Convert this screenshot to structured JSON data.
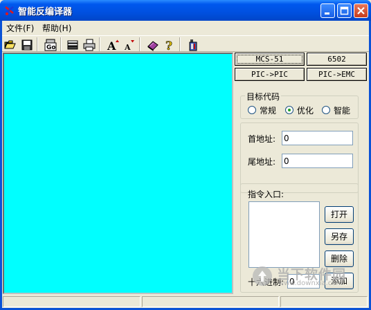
{
  "window": {
    "title": "智能反编译器"
  },
  "menu": [
    {
      "label": "文件(F)"
    },
    {
      "label": "帮助(H)"
    }
  ],
  "toolbar": {
    "buttons": [
      {
        "icon": "open-folder-icon"
      },
      {
        "icon": "save-disk-icon"
      },
      {
        "icon": "go-icon",
        "label": "Go"
      },
      {
        "icon": "print-setup-icon"
      },
      {
        "icon": "print-icon"
      },
      {
        "icon": "font-increase-icon",
        "label": "A"
      },
      {
        "icon": "font-decrease-icon",
        "label": "A"
      },
      {
        "icon": "book-icon"
      },
      {
        "icon": "help-icon",
        "label": "?"
      },
      {
        "icon": "about-icon"
      }
    ]
  },
  "display": {
    "background": "#00ffff"
  },
  "cpu_buttons": [
    {
      "label": "MCS-51"
    },
    {
      "label": "6502"
    },
    {
      "label": "PIC->PIC"
    },
    {
      "label": "PIC->EMC"
    }
  ],
  "target_code": {
    "title": "目标代码",
    "options": [
      {
        "label": "常规",
        "checked": false
      },
      {
        "label": "优化",
        "checked": true
      },
      {
        "label": "智能",
        "checked": false
      }
    ]
  },
  "address": {
    "start_label": "首地址:",
    "start_value": "0",
    "end_label": "尾地址:",
    "end_value": "0"
  },
  "instruction": {
    "title": "指令入口:",
    "buttons": [
      {
        "label": "打开"
      },
      {
        "label": "另存"
      },
      {
        "label": "删除"
      },
      {
        "label": "添加"
      }
    ],
    "hex_label": "十六进制:",
    "hex_value": "0"
  },
  "watermark": {
    "brand": "当下软件园",
    "url": "www.downxia.com"
  },
  "colors": {
    "titlebar": "#0054e3",
    "accent_display": "#00ffff",
    "radio_dot": "#21a121"
  }
}
